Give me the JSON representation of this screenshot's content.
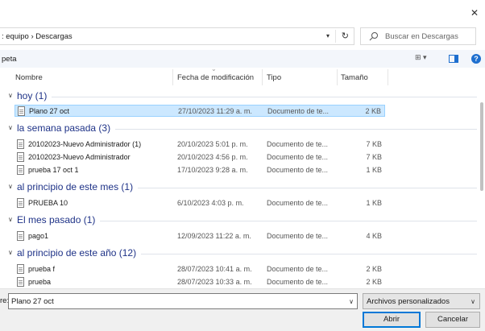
{
  "address": {
    "path": ": equipo  ›  Descargas"
  },
  "search": {
    "placeholder": "Buscar en Descargas"
  },
  "toolbar": {
    "organize": "peta",
    "views_icon": "view-options-icon",
    "help": "?"
  },
  "columns": {
    "name": "Nombre",
    "date": "Fecha de modificación",
    "type": "Tipo",
    "size": "Tamaño"
  },
  "groups": [
    {
      "label": "hoy (1)",
      "files": [
        {
          "name": "Plano 27 oct",
          "date": "27/10/2023 11:29 a. m.",
          "type": "Documento de te...",
          "size": "2 KB",
          "selected": true
        }
      ]
    },
    {
      "label": "la semana pasada (3)",
      "files": [
        {
          "name": "20102023-Nuevo Administrador (1)",
          "date": "20/10/2023 5:01 p. m.",
          "type": "Documento de te...",
          "size": "7 KB"
        },
        {
          "name": "20102023-Nuevo Administrador",
          "date": "20/10/2023 4:56 p. m.",
          "type": "Documento de te...",
          "size": "7 KB"
        },
        {
          "name": "prueba 17 oct 1",
          "date": "17/10/2023 9:28 a. m.",
          "type": "Documento de te...",
          "size": "1 KB"
        }
      ]
    },
    {
      "label": "al principio de este mes (1)",
      "files": [
        {
          "name": "PRUEBA 10",
          "date": "6/10/2023 4:03 p. m.",
          "type": "Documento de te...",
          "size": "1 KB"
        }
      ]
    },
    {
      "label": "El mes pasado (1)",
      "files": [
        {
          "name": "pago1",
          "date": "12/09/2023 11:22 a. m.",
          "type": "Documento de te...",
          "size": "4 KB"
        }
      ]
    },
    {
      "label": "al principio de este año (12)",
      "files": [
        {
          "name": "prueba f",
          "date": "28/07/2023 10:41 a. m.",
          "type": "Documento de te...",
          "size": "2 KB"
        },
        {
          "name": "prueba",
          "date": "28/07/2023 10:33 a. m.",
          "type": "Documento de te...",
          "size": "2 KB"
        }
      ]
    }
  ],
  "filename": {
    "label": "re:",
    "value": "Plano 27 oct"
  },
  "filter": {
    "value": "Archivos personalizados"
  },
  "buttons": {
    "open": "Abrir",
    "cancel": "Cancelar"
  },
  "colors": {
    "accent": "#1e6fcf",
    "group_label": "#1e3287",
    "selection": "#cce8ff"
  }
}
